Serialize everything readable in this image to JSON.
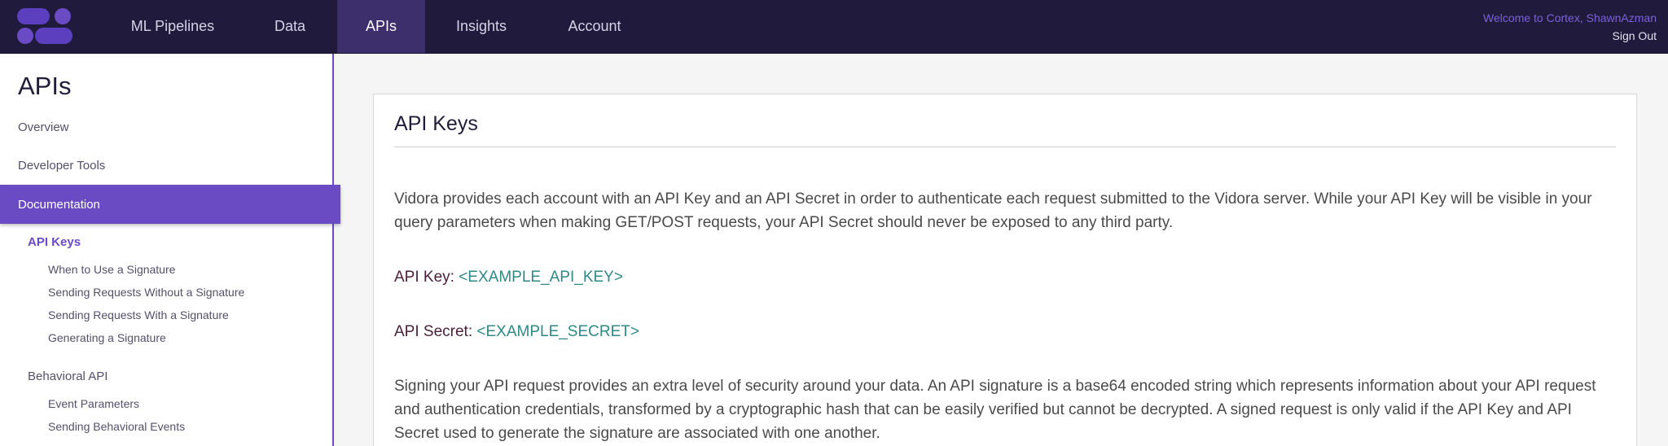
{
  "nav": {
    "items": [
      "ML Pipelines",
      "Data",
      "APIs",
      "Insights",
      "Account"
    ],
    "active": "APIs",
    "welcome": "Welcome to Cortex, ShawnAzman",
    "sign_out": "Sign Out"
  },
  "sidebar": {
    "title": "APIs",
    "overview": "Overview",
    "developer_tools": "Developer Tools",
    "documentation": "Documentation",
    "api_keys": "API Keys",
    "api_keys_children": [
      "When to Use a Signature",
      "Sending Requests Without a Signature",
      "Sending Requests With a Signature",
      "Generating a Signature"
    ],
    "behavioral_api": "Behavioral API",
    "behavioral_children": [
      "Event Parameters",
      "Sending Behavioral Events"
    ]
  },
  "content": {
    "title": "API Keys",
    "intro": "Vidora provides each account with an API Key and an API Secret in order to authenticate each request submitted to the Vidora server. While your API Key will be visible in your query parameters when making GET/POST requests, your API Secret should never be exposed to any third party.",
    "api_key_label": "API Key:",
    "api_key_value": "<EXAMPLE_API_KEY>",
    "api_secret_label": "API Secret:",
    "api_secret_value": "<EXAMPLE_SECRET>",
    "signing": "Signing your API request provides an extra level of security around your data. An API signature is a base64 encoded string which represents information about your API request and authentication credentials, transformed by a cryptographic hash that can be easily verified but cannot be decrypted. A signed request is only valid if the API Key and API Secret used to generate the signature are associated with one another."
  },
  "colors": {
    "topbar": "#201a3c",
    "accent": "#6a4bc4",
    "logo_purple": "#6a4bc4",
    "value_teal": "#2f8a86"
  },
  "icons": {
    "logo": "cortex-logo"
  }
}
